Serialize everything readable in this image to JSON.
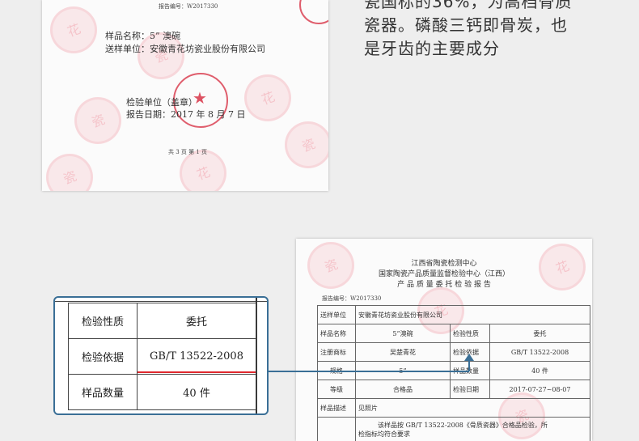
{
  "top_report": {
    "report_no": "报告编号：W2017330",
    "sample_name": "样品名称：5” 澳碗",
    "sender": "送样单位：安徽青花坊瓷业股份有限公司",
    "inspect_unit": "检验单位（盖章）",
    "report_date": "报告日期：2017 年 8 月 7 日",
    "page_no": "共 3 页 第 1 页"
  },
  "right_text": {
    "line1": "瓷国标的36%，为高档骨质",
    "line2": "瓷器。磷酸三钙即骨炭，也",
    "line3": "是牙齿的主要成分"
  },
  "bottom_report": {
    "org1": "江西省陶瓷检测中心",
    "org2": "国家陶瓷产品质量监督检验中心（江西）",
    "title": "产 品 质 量 委 托 检 验 报 告",
    "report_no": "报告编号：W2017330",
    "rows": {
      "sender_label": "送样单位",
      "sender_value": "安徽青花坊瓷业股份有限公司",
      "sample_name_label": "样品名称",
      "sample_name_value": "5”澳碗",
      "nature_label": "检验性质",
      "nature_value": "委托",
      "trademark_label": "注册商标",
      "trademark_value": "吴楚青花",
      "basis_label": "检验依据",
      "basis_value": "GB/T 13522-2008",
      "spec_label": "规格",
      "spec_value": "5”",
      "qty_label": "样品数量",
      "qty_value": "40 件",
      "grade_label": "等级",
      "grade_value": "合格品",
      "date_label": "检验日期",
      "date_value": "2017-07-27~08-07",
      "desc_label": "样品描述",
      "desc_value": "见照片",
      "conclusion_line1": "该样品按 GB/T 13522-2008《骨质瓷器》合格品检验，所",
      "conclusion_line2": "检指标均符合要求"
    }
  },
  "zoom_box": {
    "nature_label": "检验性质",
    "nature_value": "委托",
    "basis_label": "检验依据",
    "basis_value": "GB/T 13522-2008",
    "qty_label": "样品数量",
    "qty_value": "40 件"
  },
  "colors": {
    "connector": "#3a6f96",
    "underline": "#e0282e",
    "watermark": "#e8465a"
  }
}
